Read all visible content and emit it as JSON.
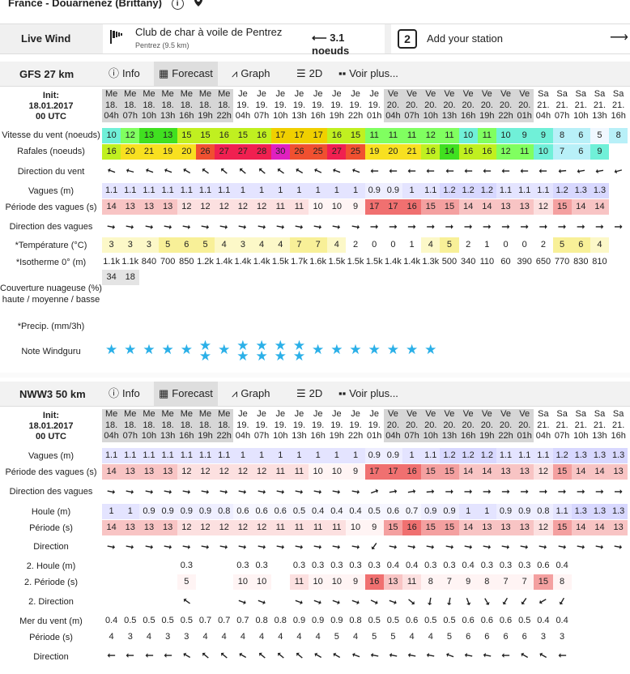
{
  "header": {
    "title": "France - Douarnenez (Brittany)",
    "info_icon": "i",
    "pin_icon": "map-pin-icon"
  },
  "live": {
    "label": "Live Wind",
    "station_name": "Club de char à voile de Pentrez",
    "station_sub": "Pentrez  (9.5 km)",
    "station_value": "3.1 noeuds",
    "add_label": "Add your station",
    "add_number": "2"
  },
  "tabs": {
    "info": "Info",
    "forecast": "Forecast",
    "graph": "Graph",
    "twod": "2D",
    "more": "Voir plus..."
  },
  "gfs": {
    "model": "GFS 27 km",
    "init": [
      "Init:",
      "18.01.2017",
      "00 UTC"
    ],
    "days": [
      "Me",
      "Me",
      "Me",
      "Me",
      "Me",
      "Me",
      "Me",
      "Je",
      "Je",
      "Je",
      "Je",
      "Je",
      "Je",
      "Je",
      "Je",
      "Ve",
      "Ve",
      "Ve",
      "Ve",
      "Ve",
      "Ve",
      "Ve",
      "Ve",
      "Sa",
      "Sa",
      "Sa",
      "Sa",
      "Sa",
      "Sa"
    ],
    "dates": [
      "18.",
      "18.",
      "18.",
      "18.",
      "18.",
      "18.",
      "18.",
      "19.",
      "19.",
      "19.",
      "19.",
      "19.",
      "19.",
      "19.",
      "19.",
      "20.",
      "20.",
      "20.",
      "20.",
      "20.",
      "20.",
      "20.",
      "20.",
      "21.",
      "21.",
      "21.",
      "21.",
      "21.",
      "21."
    ],
    "hours": [
      "04h",
      "07h",
      "10h",
      "13h",
      "16h",
      "19h",
      "22h",
      "04h",
      "07h",
      "10h",
      "13h",
      "16h",
      "19h",
      "22h",
      "01h",
      "04h",
      "07h",
      "10h",
      "13h",
      "16h",
      "19h",
      "22h",
      "01h",
      "04h",
      "07h",
      "10h",
      "13h",
      "16h",
      "19h"
    ],
    "labels": {
      "wind": "Vitesse du vent (noeuds)",
      "gust": "Rafales (noeuds)",
      "wdir": "Direction du vent",
      "waves": "Vagues (m)",
      "wper": "Période des vagues (s)",
      "wvdir": "Direction des vagues",
      "temp": "*Température (°C)",
      "iso": "*Isotherme 0° (m)",
      "cloud1": "Couverture nuageuse (%)",
      "cloud2": "haute / moyenne / basse",
      "precip": "*Precip. (mm/3h)",
      "rating": "Note Windguru"
    },
    "wind": [
      "10",
      "12",
      "13",
      "13",
      "15",
      "15",
      "16",
      "15",
      "16",
      "17",
      "17",
      "17",
      "16",
      "15",
      "11",
      "11",
      "11",
      "12",
      "11",
      "10",
      "11",
      "10",
      "9",
      "9",
      "8",
      "6",
      "5",
      "8",
      ""
    ],
    "gust": [
      "16",
      "20",
      "21",
      "19",
      "20",
      "26",
      "27",
      "27",
      "28",
      "30",
      "26",
      "25",
      "27",
      "25",
      "19",
      "20",
      "21",
      "16",
      "14",
      "16",
      "16",
      "12",
      "11",
      "10",
      "7",
      "6",
      "9",
      "",
      ""
    ],
    "waves": [
      "1.1",
      "1.1",
      "1.1",
      "1.1",
      "1.1",
      "1.1",
      "1.1",
      "1",
      "1",
      "1",
      "1",
      "1",
      "1",
      "1",
      "0.9",
      "0.9",
      "1",
      "1.1",
      "1.2",
      "1.2",
      "1.2",
      "1.1",
      "1.1",
      "1.1",
      "1.2",
      "1.3",
      "1.3",
      "",
      ""
    ],
    "wper": [
      "14",
      "13",
      "13",
      "13",
      "12",
      "12",
      "12",
      "12",
      "12",
      "11",
      "11",
      "10",
      "10",
      "9",
      "17",
      "17",
      "16",
      "15",
      "15",
      "14",
      "14",
      "13",
      "13",
      "12",
      "15",
      "14",
      "14",
      "",
      ""
    ],
    "temp": [
      "3",
      "3",
      "3",
      "5",
      "6",
      "5",
      "4",
      "3",
      "4",
      "4",
      "7",
      "7",
      "4",
      "2",
      "0",
      "0",
      "1",
      "4",
      "5",
      "2",
      "1",
      "0",
      "0",
      "2",
      "5",
      "6",
      "4",
      "",
      ""
    ],
    "iso": [
      "1.1k",
      "1.1k",
      "840",
      "700",
      "850",
      "1.2k",
      "1.4k",
      "1.4k",
      "1.4k",
      "1.5k",
      "1.7k",
      "1.6k",
      "1.5k",
      "1.5k",
      "1.5k",
      "1.4k",
      "1.4k",
      "1.3k",
      "500",
      "340",
      "110",
      "60",
      "390",
      "650",
      "770",
      "830",
      "810",
      "",
      ""
    ],
    "cloud": [
      "34",
      "18"
    ],
    "stars": [
      1,
      1,
      1,
      1,
      1,
      2,
      1,
      2,
      2,
      2,
      2,
      1,
      1,
      1,
      1,
      1,
      1,
      1
    ]
  },
  "nww3": {
    "model": "NWW3 50 km",
    "init": [
      "Init:",
      "18.01.2017",
      "00 UTC"
    ],
    "labels": {
      "waves": "Vagues (m)",
      "wper": "Période des vagues (s)",
      "wvdir": "Direction des vagues",
      "swell": "Houle (m)",
      "sper": "Période (s)",
      "sdir": "Direction",
      "swell2": "2. Houle (m)",
      "sper2": "2. Période (s)",
      "sdir2": "2. Direction",
      "windsea": "Mer du vent (m)",
      "wsper": "Période (s)",
      "wsdir": "Direction"
    },
    "waves": [
      "1.1",
      "1.1",
      "1.1",
      "1.1",
      "1.1",
      "1.1",
      "1.1",
      "1",
      "1",
      "1",
      "1",
      "1",
      "1",
      "1",
      "0.9",
      "0.9",
      "1",
      "1.1",
      "1.2",
      "1.2",
      "1.2",
      "1.1",
      "1.1",
      "1.1",
      "1.2",
      "1.3",
      "1.3",
      "1.3",
      ""
    ],
    "wper": [
      "14",
      "13",
      "13",
      "13",
      "12",
      "12",
      "12",
      "12",
      "12",
      "11",
      "11",
      "10",
      "10",
      "9",
      "17",
      "17",
      "16",
      "15",
      "15",
      "14",
      "14",
      "13",
      "13",
      "12",
      "15",
      "14",
      "14",
      "13",
      ""
    ],
    "swell": [
      "1",
      "1",
      "0.9",
      "0.9",
      "0.9",
      "0.9",
      "0.8",
      "0.6",
      "0.6",
      "0.6",
      "0.5",
      "0.4",
      "0.4",
      "0.4",
      "0.5",
      "0.6",
      "0.7",
      "0.9",
      "0.9",
      "1",
      "1",
      "0.9",
      "0.9",
      "0.8",
      "1.1",
      "1.3",
      "1.3",
      "1.3",
      ""
    ],
    "sper": [
      "14",
      "13",
      "13",
      "13",
      "12",
      "12",
      "12",
      "12",
      "12",
      "11",
      "11",
      "11",
      "11",
      "10",
      "9",
      "15",
      "16",
      "15",
      "15",
      "14",
      "13",
      "13",
      "13",
      "12",
      "15",
      "14",
      "14",
      "13",
      ""
    ],
    "swell2": [
      "",
      "",
      "",
      "",
      "0.3",
      "",
      "",
      "0.3",
      "0.3",
      "",
      "0.3",
      "0.3",
      "0.3",
      "0.3",
      "0.3",
      "0.4",
      "0.4",
      "0.3",
      "0.3",
      "0.4",
      "0.3",
      "0.3",
      "0.3",
      "0.6",
      "0.4",
      "",
      "",
      "",
      ""
    ],
    "sper2": [
      "",
      "",
      "",
      "",
      "5",
      "",
      "",
      "10",
      "10",
      "",
      "11",
      "10",
      "10",
      "9",
      "16",
      "13",
      "11",
      "8",
      "7",
      "9",
      "8",
      "7",
      "7",
      "15",
      "8",
      "",
      "",
      "",
      ""
    ],
    "windsea": [
      "0.4",
      "0.5",
      "0.5",
      "0.5",
      "0.5",
      "0.7",
      "0.7",
      "0.7",
      "0.8",
      "0.8",
      "0.9",
      "0.9",
      "0.9",
      "0.8",
      "0.5",
      "0.5",
      "0.6",
      "0.5",
      "0.5",
      "0.6",
      "0.6",
      "0.6",
      "0.5",
      "0.4",
      "0.4",
      "",
      "",
      "",
      "0.2"
    ],
    "wsper": [
      "4",
      "3",
      "4",
      "3",
      "3",
      "4",
      "4",
      "4",
      "4",
      "4",
      "4",
      "4",
      "5",
      "4",
      "5",
      "5",
      "4",
      "4",
      "5",
      "6",
      "6",
      "6",
      "6",
      "3",
      "3",
      "",
      "",
      "",
      "5"
    ]
  },
  "colors": {
    "accent": "#2bb0e8",
    "header_bg": "#f0f0f0",
    "gray_col": "#d6d6d6"
  }
}
